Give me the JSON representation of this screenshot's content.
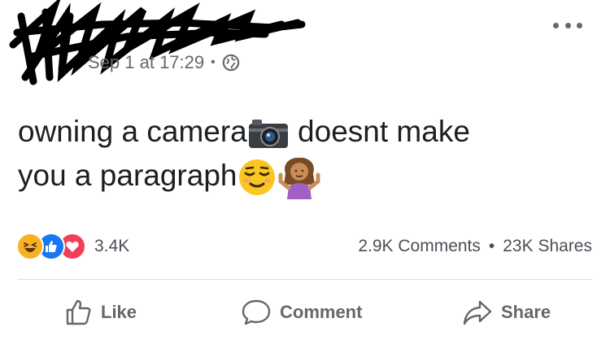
{
  "post": {
    "timestamp": "Sep 1 at 17:29",
    "separator": "•",
    "privacy_icon": "globe-icon",
    "menu_icon": "more-options-icon",
    "text_line1": "owning a camera",
    "text_line1b": "doesnt make",
    "text_line2": "you a paragraph",
    "emojis": [
      "camera-emoji",
      "relieved-face-emoji",
      "person-shrugging-emoji"
    ]
  },
  "reactions": {
    "icons": [
      "haha-reaction-icon",
      "like-reaction-icon",
      "love-reaction-icon"
    ],
    "count": "3.4K",
    "comments": "2.9K Comments",
    "stats_separator": "•",
    "shares": "23K Shares"
  },
  "actions": {
    "like": "Like",
    "comment": "Comment",
    "share": "Share"
  },
  "colors": {
    "like_blue": "#1877f2",
    "love_red": "#f33e58",
    "haha_yellow": "#f7b125",
    "secondary_text": "#65676b"
  }
}
